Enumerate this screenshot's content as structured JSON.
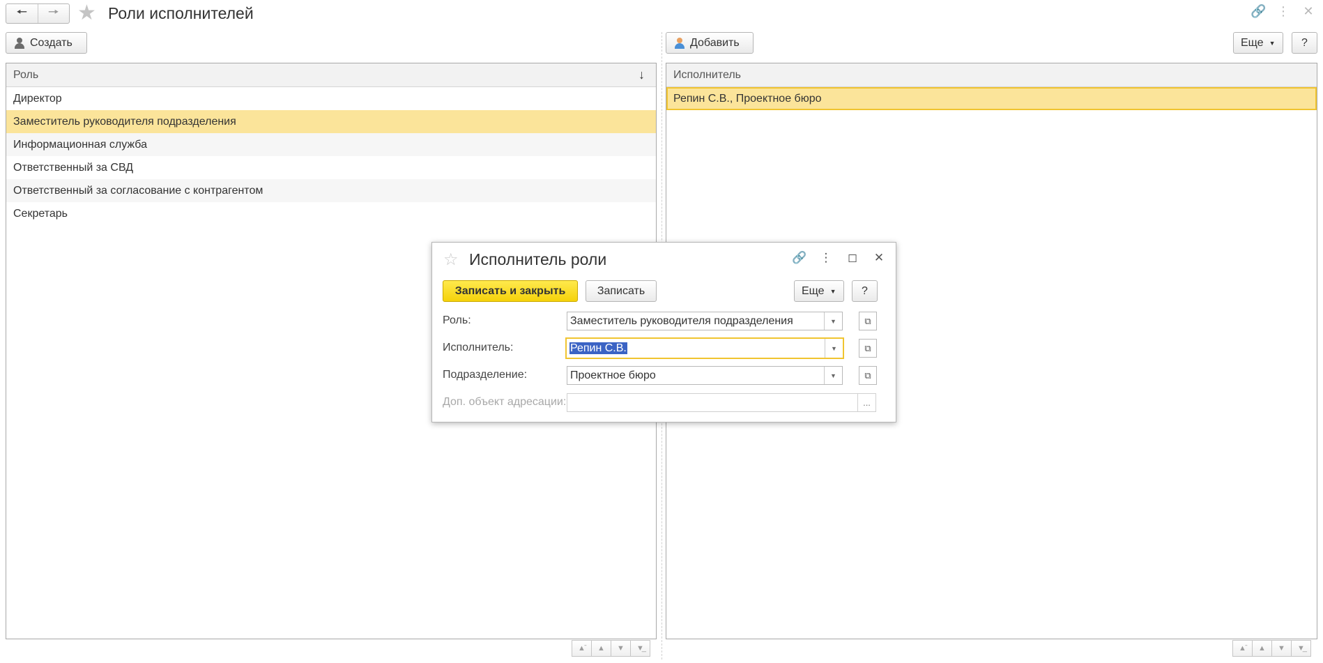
{
  "window": {
    "title": "Роли исполнителей",
    "back_icon": "arrow-left-icon",
    "forward_icon": "arrow-right-icon",
    "favorite_icon": "star-icon",
    "link_icon": "link-icon",
    "menu_icon": "more-vertical-icon",
    "close_icon": "close-icon"
  },
  "left_toolbar": {
    "create_label": "Создать"
  },
  "right_toolbar": {
    "add_label": "Добавить",
    "more_label": "Еще",
    "help_label": "?"
  },
  "roles_table": {
    "column_header": "Роль",
    "sort_indicator": "↓",
    "rows": [
      "Директор",
      "Заместитель руководителя подразделения",
      "Информационная служба",
      "Ответственный за СВД",
      "Ответственный за согласование с контрагентом",
      "Секретарь"
    ],
    "selected_index": 1
  },
  "performers_table": {
    "column_header": "Исполнитель",
    "rows": [
      "Репин С.В., Проектное бюро"
    ],
    "selected_index": 0
  },
  "dialog": {
    "title": "Исполнитель роли",
    "save_close_label": "Записать и закрыть",
    "save_label": "Записать",
    "more_label": "Еще",
    "help_label": "?",
    "fields": {
      "role": {
        "label": "Роль:",
        "value": "Заместитель руководителя подразделения"
      },
      "performer": {
        "label": "Исполнитель:",
        "value": "Репин С.В."
      },
      "department": {
        "label": "Подразделение:",
        "value": "Проектное бюро"
      },
      "extra_object": {
        "label": "Доп. объект адресации:",
        "value": ""
      }
    }
  },
  "colors": {
    "selection": "#fbe49a",
    "selection_border": "#f0c430",
    "primary_button": "#f5d20a",
    "text_highlight": "#3b63c4"
  }
}
